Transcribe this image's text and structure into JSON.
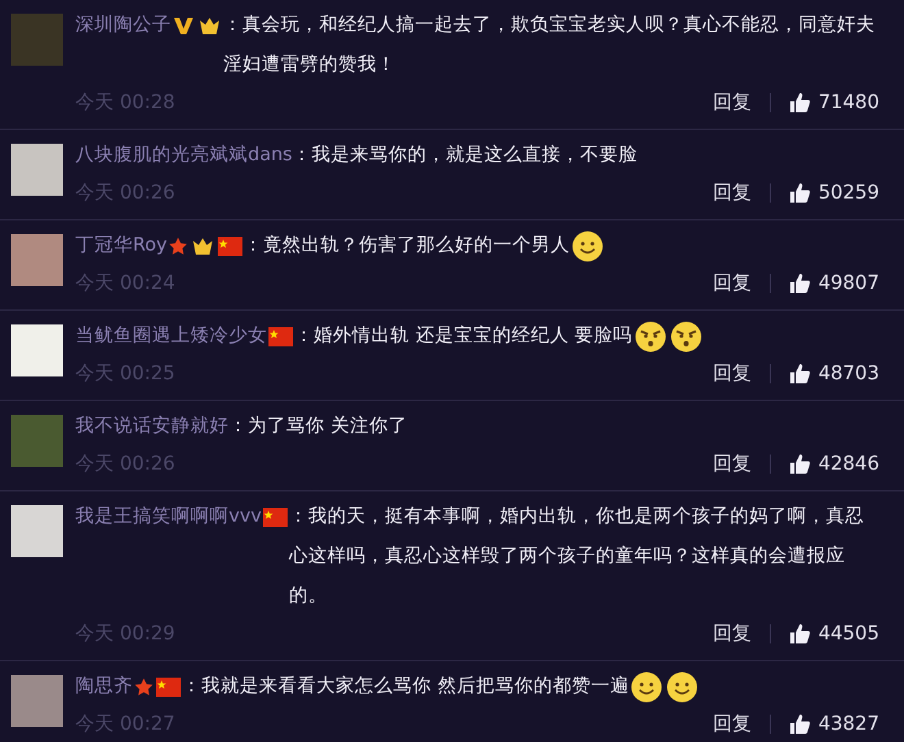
{
  "comments": [
    {
      "name": "深圳陶公子",
      "badges": [
        {
          "kind": "verified"
        },
        {
          "kind": "vip"
        }
      ],
      "text": "：真会玩，和经纪人搞一起去了，欺负宝宝老实人呗？真心不能忍，同意奸夫淫妇遭雷劈的赞我！",
      "time": "今天 00:28",
      "reply": "回复",
      "likes": "71480"
    },
    {
      "name": "八块腹肌的光亮斌斌dans",
      "text": "：我是来骂你的，就是这么直接，不要脸",
      "time": "今天 00:26",
      "reply": "回复",
      "likes": "50259"
    },
    {
      "name": "丁冠华Roy",
      "badges": [
        {
          "kind": "star"
        },
        {
          "kind": "vip"
        },
        {
          "kind": "flag"
        }
      ],
      "text": "：竟然出轨？伤害了那么好的一个男人",
      "emojis": [
        {
          "kind": "smile"
        }
      ],
      "time": "今天 00:24",
      "reply": "回复",
      "likes": "49807"
    },
    {
      "name": "当鱿鱼圈遇上矮冷少女",
      "badges": [
        {
          "kind": "flag"
        }
      ],
      "text": "：婚外情出轨  还是宝宝的经纪人  要脸吗",
      "emojis": [
        {
          "kind": "angry"
        },
        {
          "kind": "angry"
        }
      ],
      "time": "今天 00:25",
      "reply": "回复",
      "likes": "48703"
    },
    {
      "name": "我不说话安静就好",
      "text": "：为了骂你 关注你了",
      "time": "今天 00:26",
      "reply": "回复",
      "likes": "42846"
    },
    {
      "name": "我是王搞笑啊啊啊vvv",
      "badges": [
        {
          "kind": "flag"
        }
      ],
      "text": "：我的天，挺有本事啊，婚内出轨，你也是两个孩子的妈了啊，真忍心这样吗，真忍心这样毁了两个孩子的童年吗？这样真的会遭报应的。",
      "time": "今天 00:29",
      "reply": "回复",
      "likes": "44505"
    },
    {
      "name": "陶思齐",
      "badges": [
        {
          "kind": "star"
        },
        {
          "kind": "flag"
        }
      ],
      "text": "：我就是来看看大家怎么骂你 然后把骂你的都赞一遍",
      "emojis": [
        {
          "kind": "smile"
        },
        {
          "kind": "smile"
        }
      ],
      "time": "今天 00:27",
      "reply": "回复",
      "likes": "43827"
    }
  ]
}
